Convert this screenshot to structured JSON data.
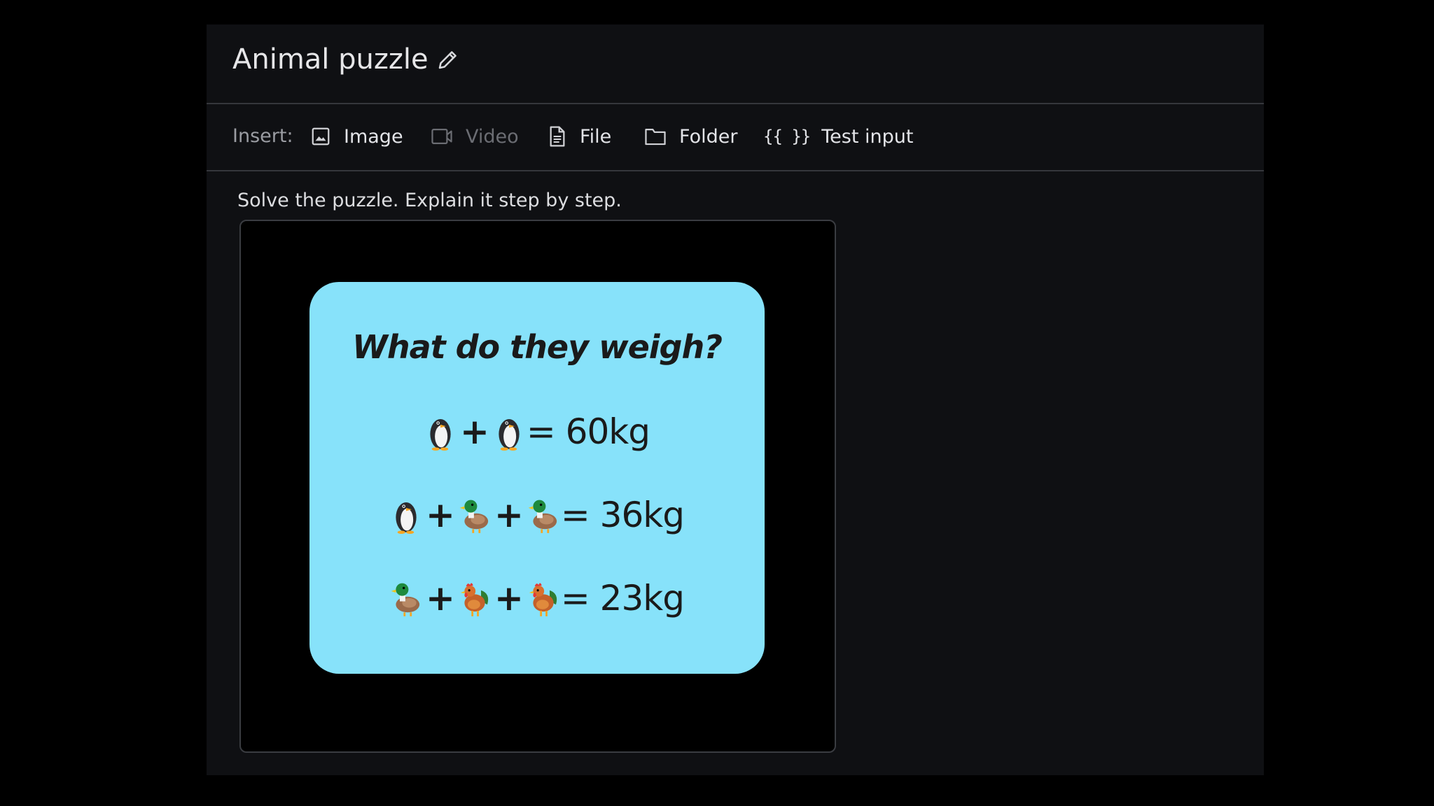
{
  "header": {
    "title": "Animal puzzle",
    "edit_icon": "pencil-icon"
  },
  "toolbar": {
    "insert_label": "Insert:",
    "items": [
      {
        "label": "Image",
        "icon": "image-icon",
        "enabled": true
      },
      {
        "label": "Video",
        "icon": "video-icon",
        "enabled": false
      },
      {
        "label": "File",
        "icon": "file-icon",
        "enabled": true
      },
      {
        "label": "Folder",
        "icon": "folder-icon",
        "enabled": true
      },
      {
        "label": "Test input",
        "icon": "braces-icon",
        "icon_text": "{{ }}",
        "enabled": true
      }
    ]
  },
  "prompt": {
    "text": "Solve the puzzle. Explain it step by step."
  },
  "puzzle_image": {
    "background": "#87e2fa",
    "title": "What do they weigh?",
    "equations": [
      {
        "terms": [
          "penguin",
          "penguin"
        ],
        "result": "= 60kg"
      },
      {
        "terms": [
          "penguin",
          "duck",
          "duck"
        ],
        "result": "= 36kg"
      },
      {
        "terms": [
          "duck",
          "rooster",
          "rooster"
        ],
        "result": "= 23kg"
      }
    ],
    "plus": "+"
  },
  "colors": {
    "page_bg": "#000000",
    "panel_bg": "#0f1013",
    "divider": "#35373c",
    "text_primary": "#e6e6e8",
    "text_muted": "#9a9ca2",
    "text_disabled": "#6b6d73"
  }
}
